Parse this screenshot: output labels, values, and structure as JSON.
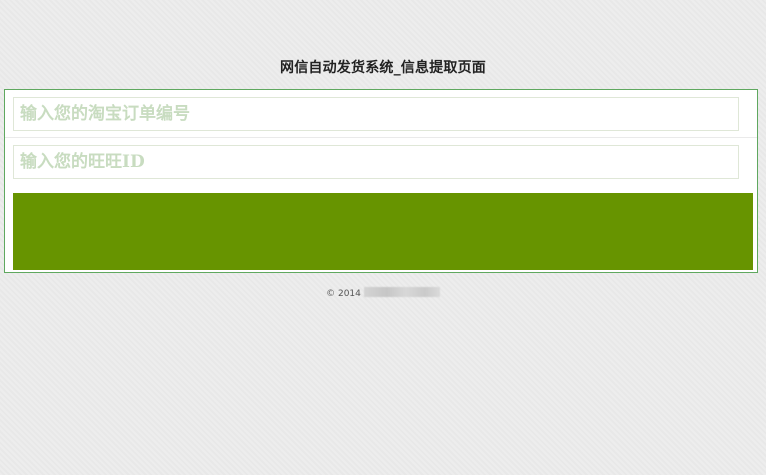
{
  "page": {
    "title": "网信自动发货系统_信息提取页面"
  },
  "form": {
    "order_number_placeholder": "输入您的淘宝订单编号",
    "order_number_value": "",
    "wangwang_id_placeholder": "输入您的旺旺ID",
    "wangwang_id_value": "",
    "submit_label": ""
  },
  "footer": {
    "copyright": "© 2014"
  },
  "colors": {
    "submit_button": "#679400",
    "panel_border": "#5fa85f",
    "placeholder_text": "#c8dcc0",
    "page_background": "#ececec"
  }
}
